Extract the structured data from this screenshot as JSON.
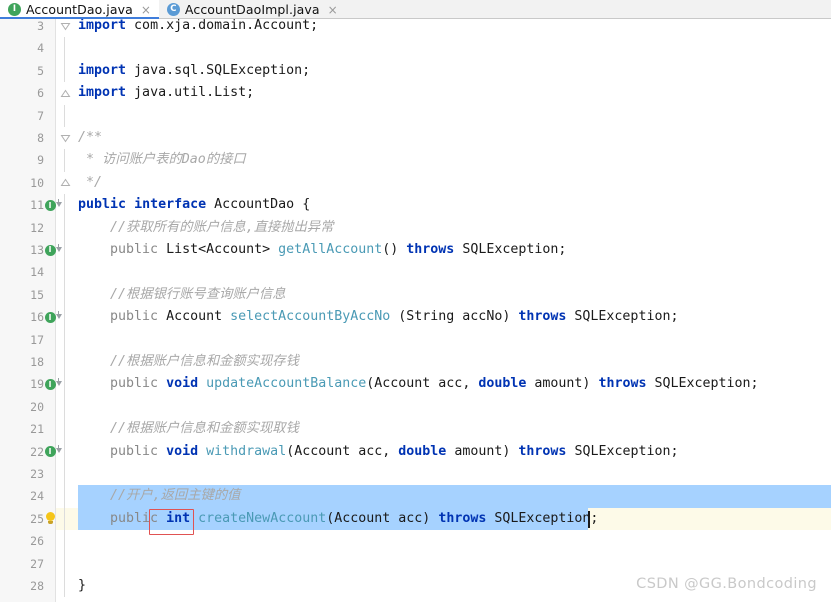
{
  "window": {
    "app": "IntelliJ IDEA Editor",
    "watermark": "CSDN @GG.Bondcoding"
  },
  "tabs": [
    {
      "label": "AccountDao.java",
      "icon": "interface-icon",
      "icon_letter": "I",
      "icon_color": "#3fa45b",
      "active": true,
      "close_glyph": "×"
    },
    {
      "label": "AccountDaoImpl.java",
      "icon": "class-icon",
      "icon_letter": "C",
      "icon_color": "#5b9bd5",
      "active": false,
      "close_glyph": "×"
    }
  ],
  "editor": {
    "first_visible_line": 3,
    "caret_line": 25,
    "selected_lines": [
      24,
      25
    ],
    "error_highlight": {
      "token": "int",
      "line": 25,
      "color": "#e05252"
    },
    "current_line_color": "#fdfae8",
    "selection_color": "#a6d2ff",
    "lines": [
      {
        "num": "3",
        "segments": [
          {
            "t": "import",
            "c": "kw"
          },
          {
            "t": " com.xja.domain.Account;",
            "c": "pl"
          }
        ]
      },
      {
        "num": "4",
        "segments": []
      },
      {
        "num": "5",
        "segments": [
          {
            "t": "import",
            "c": "kw"
          },
          {
            "t": " java.sql.SQLException;",
            "c": "pl"
          }
        ]
      },
      {
        "num": "6",
        "segments": [
          {
            "t": "import",
            "c": "kw"
          },
          {
            "t": " java.util.List;",
            "c": "pl"
          }
        ]
      },
      {
        "num": "7",
        "segments": []
      },
      {
        "num": "8",
        "segments": [
          {
            "t": "/**",
            "c": "cmt"
          }
        ]
      },
      {
        "num": "9",
        "segments": [
          {
            "t": " * 访问账户表的Dao的接口",
            "c": "cmt"
          }
        ]
      },
      {
        "num": "10",
        "segments": [
          {
            "t": " */",
            "c": "cmt"
          }
        ]
      },
      {
        "num": "11",
        "segments": [
          {
            "t": "public",
            "c": "kw"
          },
          {
            "t": " ",
            "c": "pl"
          },
          {
            "t": "interface",
            "c": "kw"
          },
          {
            "t": " AccountDao {",
            "c": "pl"
          }
        ]
      },
      {
        "num": "12",
        "segments": [
          {
            "t": "    //获取所有的账户信息,直接抛出异常",
            "c": "cmt"
          }
        ]
      },
      {
        "num": "13",
        "segments": [
          {
            "t": "    ",
            "c": "pl"
          },
          {
            "t": "public",
            "c": "gray"
          },
          {
            "t": " List<Account> ",
            "c": "pl"
          },
          {
            "t": "getAllAccount",
            "c": "meth"
          },
          {
            "t": "() ",
            "c": "pl"
          },
          {
            "t": "throws",
            "c": "kw"
          },
          {
            "t": " SQLException;",
            "c": "pl"
          }
        ]
      },
      {
        "num": "14",
        "segments": []
      },
      {
        "num": "15",
        "segments": [
          {
            "t": "    //根据银行账号查询账户信息",
            "c": "cmt"
          }
        ]
      },
      {
        "num": "16",
        "segments": [
          {
            "t": "    ",
            "c": "pl"
          },
          {
            "t": "public",
            "c": "gray"
          },
          {
            "t": " Account ",
            "c": "pl"
          },
          {
            "t": "selectAccountByAccNo",
            "c": "meth"
          },
          {
            "t": " (String accNo) ",
            "c": "pl"
          },
          {
            "t": "throws",
            "c": "kw"
          },
          {
            "t": " SQLException;",
            "c": "pl"
          }
        ]
      },
      {
        "num": "17",
        "segments": []
      },
      {
        "num": "18",
        "segments": [
          {
            "t": "    //根据账户信息和金额实现存钱",
            "c": "cmt"
          }
        ]
      },
      {
        "num": "19",
        "segments": [
          {
            "t": "    ",
            "c": "pl"
          },
          {
            "t": "public",
            "c": "gray"
          },
          {
            "t": " ",
            "c": "pl"
          },
          {
            "t": "void",
            "c": "kw"
          },
          {
            "t": " ",
            "c": "pl"
          },
          {
            "t": "updateAccountBalance",
            "c": "meth"
          },
          {
            "t": "(Account acc, ",
            "c": "pl"
          },
          {
            "t": "double",
            "c": "kw"
          },
          {
            "t": " amount) ",
            "c": "pl"
          },
          {
            "t": "throws",
            "c": "kw"
          },
          {
            "t": " SQLException;",
            "c": "pl"
          }
        ]
      },
      {
        "num": "20",
        "segments": []
      },
      {
        "num": "21",
        "segments": [
          {
            "t": "    //根据账户信息和金额实现取钱",
            "c": "cmt"
          }
        ]
      },
      {
        "num": "22",
        "segments": [
          {
            "t": "    ",
            "c": "pl"
          },
          {
            "t": "public",
            "c": "gray"
          },
          {
            "t": " ",
            "c": "pl"
          },
          {
            "t": "void",
            "c": "kw"
          },
          {
            "t": " ",
            "c": "pl"
          },
          {
            "t": "withdrawal",
            "c": "meth"
          },
          {
            "t": "(Account acc, ",
            "c": "pl"
          },
          {
            "t": "double",
            "c": "kw"
          },
          {
            "t": " amount) ",
            "c": "pl"
          },
          {
            "t": "throws",
            "c": "kw"
          },
          {
            "t": " SQLException;",
            "c": "pl"
          }
        ]
      },
      {
        "num": "23",
        "segments": []
      },
      {
        "num": "24",
        "segments": [
          {
            "t": "    //开户,返回主键的值",
            "c": "cmt"
          }
        ]
      },
      {
        "num": "25",
        "segments": [
          {
            "t": "    ",
            "c": "pl"
          },
          {
            "t": "public",
            "c": "gray"
          },
          {
            "t": " ",
            "c": "pl"
          },
          {
            "t": "int",
            "c": "kw"
          },
          {
            "t": " ",
            "c": "pl"
          },
          {
            "t": "createNewAccount",
            "c": "meth"
          },
          {
            "t": "(Account acc) ",
            "c": "pl"
          },
          {
            "t": "throws",
            "c": "kw"
          },
          {
            "t": " SQLException;",
            "c": "pl"
          }
        ]
      },
      {
        "num": "26",
        "segments": []
      },
      {
        "num": "27",
        "segments": []
      },
      {
        "num": "28",
        "segments": [
          {
            "t": "}",
            "c": "pl"
          }
        ]
      }
    ],
    "gutter_markers": [
      {
        "line": "11",
        "type": "interface-implemented-icon",
        "letter": "I"
      },
      {
        "line": "13",
        "type": "interface-implemented-icon",
        "letter": "I"
      },
      {
        "line": "16",
        "type": "interface-implemented-icon",
        "letter": "I"
      },
      {
        "line": "19",
        "type": "interface-implemented-icon",
        "letter": "I"
      },
      {
        "line": "22",
        "type": "interface-implemented-icon",
        "letter": "I"
      },
      {
        "line": "25",
        "type": "intention-bulb-icon",
        "letter": ""
      }
    ],
    "fold_markers": [
      {
        "line": "3",
        "dir": "down"
      },
      {
        "line": "6",
        "dir": "up"
      },
      {
        "line": "8",
        "dir": "down"
      },
      {
        "line": "10",
        "dir": "up"
      }
    ]
  }
}
